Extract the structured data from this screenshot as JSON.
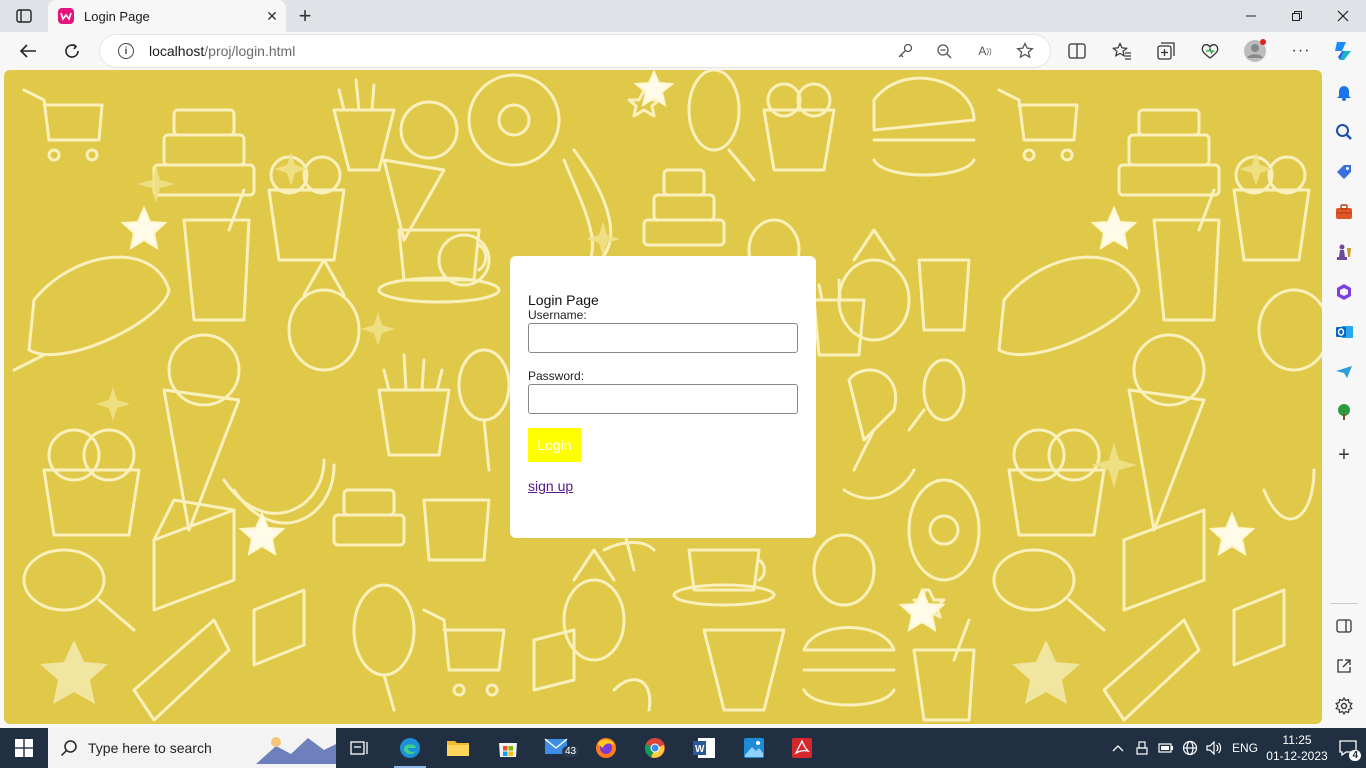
{
  "browser": {
    "tab": {
      "title": "Login Page",
      "favicon": "webpage-w-icon"
    },
    "url_host": "localhost",
    "url_path": "/proj/login.html",
    "window_controls": [
      "minimize-icon",
      "restore-icon",
      "close-icon"
    ]
  },
  "page": {
    "background_color": "#e0c948",
    "login": {
      "title": "Login Page",
      "username_label": "Username:",
      "username_value": "",
      "password_label": "Password:",
      "password_value": "",
      "login_button": "Login",
      "signup_link": "sign up"
    }
  },
  "sidebar": {
    "items": [
      "bell-icon",
      "search-icon",
      "tag-icon",
      "briefcase-icon",
      "chess-icon",
      "office-icon",
      "outlook-icon",
      "paper-plane-icon",
      "tree-icon",
      "plus-icon"
    ],
    "bottom_items": [
      "split-screen-icon",
      "external-link-icon",
      "settings-icon"
    ]
  },
  "taskbar": {
    "search_placeholder": "Type here to search",
    "mail_badge": "43",
    "language": "ENG",
    "time": "11:25",
    "date": "01-12-2023",
    "notification_count": "4"
  }
}
